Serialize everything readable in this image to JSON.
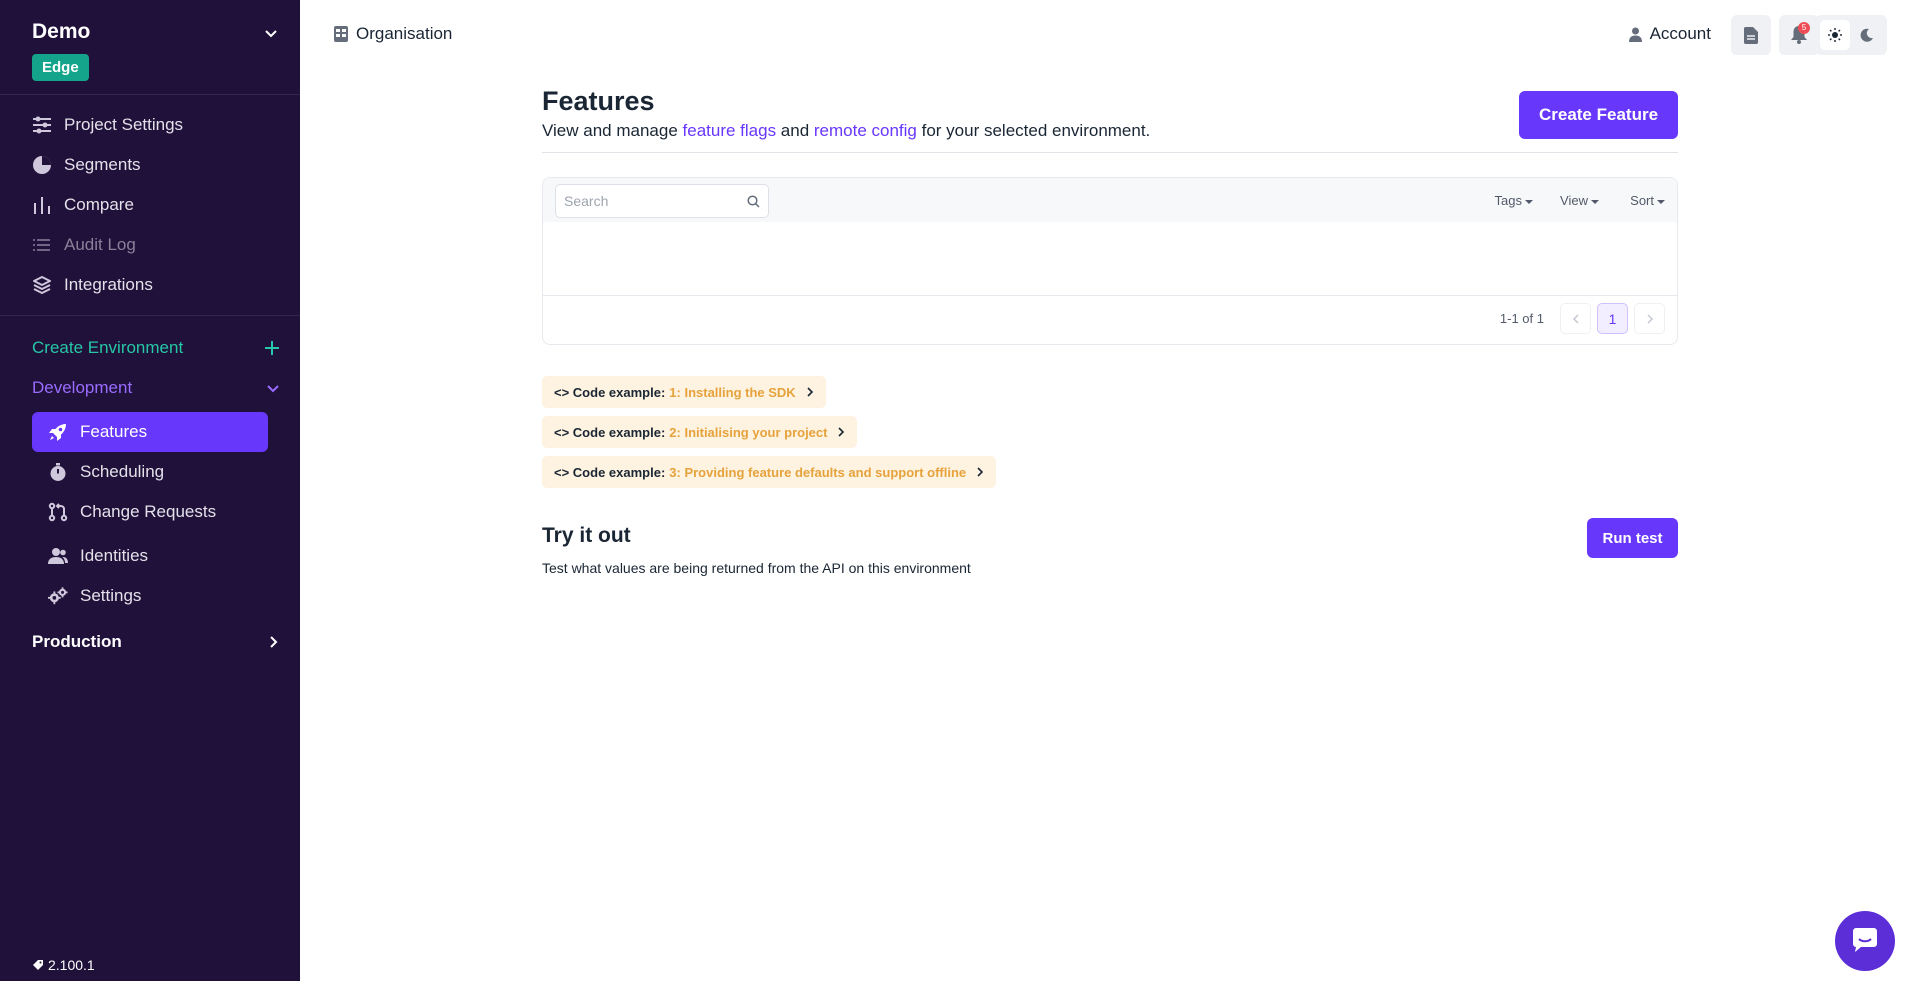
{
  "project": {
    "name": "Demo",
    "badge": "Edge"
  },
  "sidebar": {
    "project_items": [
      {
        "label": "Project Settings",
        "icon": "sliders-icon",
        "disabled": false
      },
      {
        "label": "Segments",
        "icon": "pie-chart-icon",
        "disabled": false
      },
      {
        "label": "Compare",
        "icon": "bar-chart-icon",
        "disabled": false
      },
      {
        "label": "Audit Log",
        "icon": "list-icon",
        "disabled": true
      },
      {
        "label": "Integrations",
        "icon": "layers-icon",
        "disabled": false
      }
    ],
    "create_environment": "Create Environment",
    "environments": [
      {
        "name": "Development",
        "expanded": true
      },
      {
        "name": "Production",
        "expanded": false
      }
    ],
    "env_items": [
      {
        "label": "Features",
        "icon": "rocket-icon",
        "active": true
      },
      {
        "label": "Scheduling",
        "icon": "stopwatch-icon",
        "active": false
      },
      {
        "label": "Change Requests",
        "icon": "git-pull-icon",
        "active": false
      },
      {
        "label": "Identities",
        "icon": "people-icon",
        "active": false
      },
      {
        "label": "Settings",
        "icon": "gears-icon",
        "active": false
      }
    ],
    "version": "2.100.1"
  },
  "topbar": {
    "organisation": "Organisation",
    "account": "Account",
    "notifications_count": "5"
  },
  "features": {
    "title": "Features",
    "desc_prefix": "View and manage ",
    "link_flags": "feature flags",
    "desc_and": " and ",
    "link_remote": "remote config",
    "desc_suffix": " for your selected environment.",
    "create_button": "Create Feature",
    "search_placeholder": "Search",
    "filters": {
      "tags": "Tags",
      "view": "View",
      "sort": "Sort"
    },
    "pagination": {
      "range": "1-1 of 1",
      "current_page": "1"
    }
  },
  "code_examples": {
    "label": "<> Code example:",
    "items": [
      "1: Installing the SDK",
      "2: Initialising your project",
      "3: Providing feature defaults and support offline"
    ]
  },
  "try_it": {
    "title": "Try it out",
    "desc": "Test what values are being returned from the API on this environment",
    "button": "Run test"
  },
  "colors": {
    "sidebar_bg": "#1f1139",
    "primary": "#6837fc",
    "teal": "#27c6a6",
    "code_accent": "#e6a23c"
  }
}
